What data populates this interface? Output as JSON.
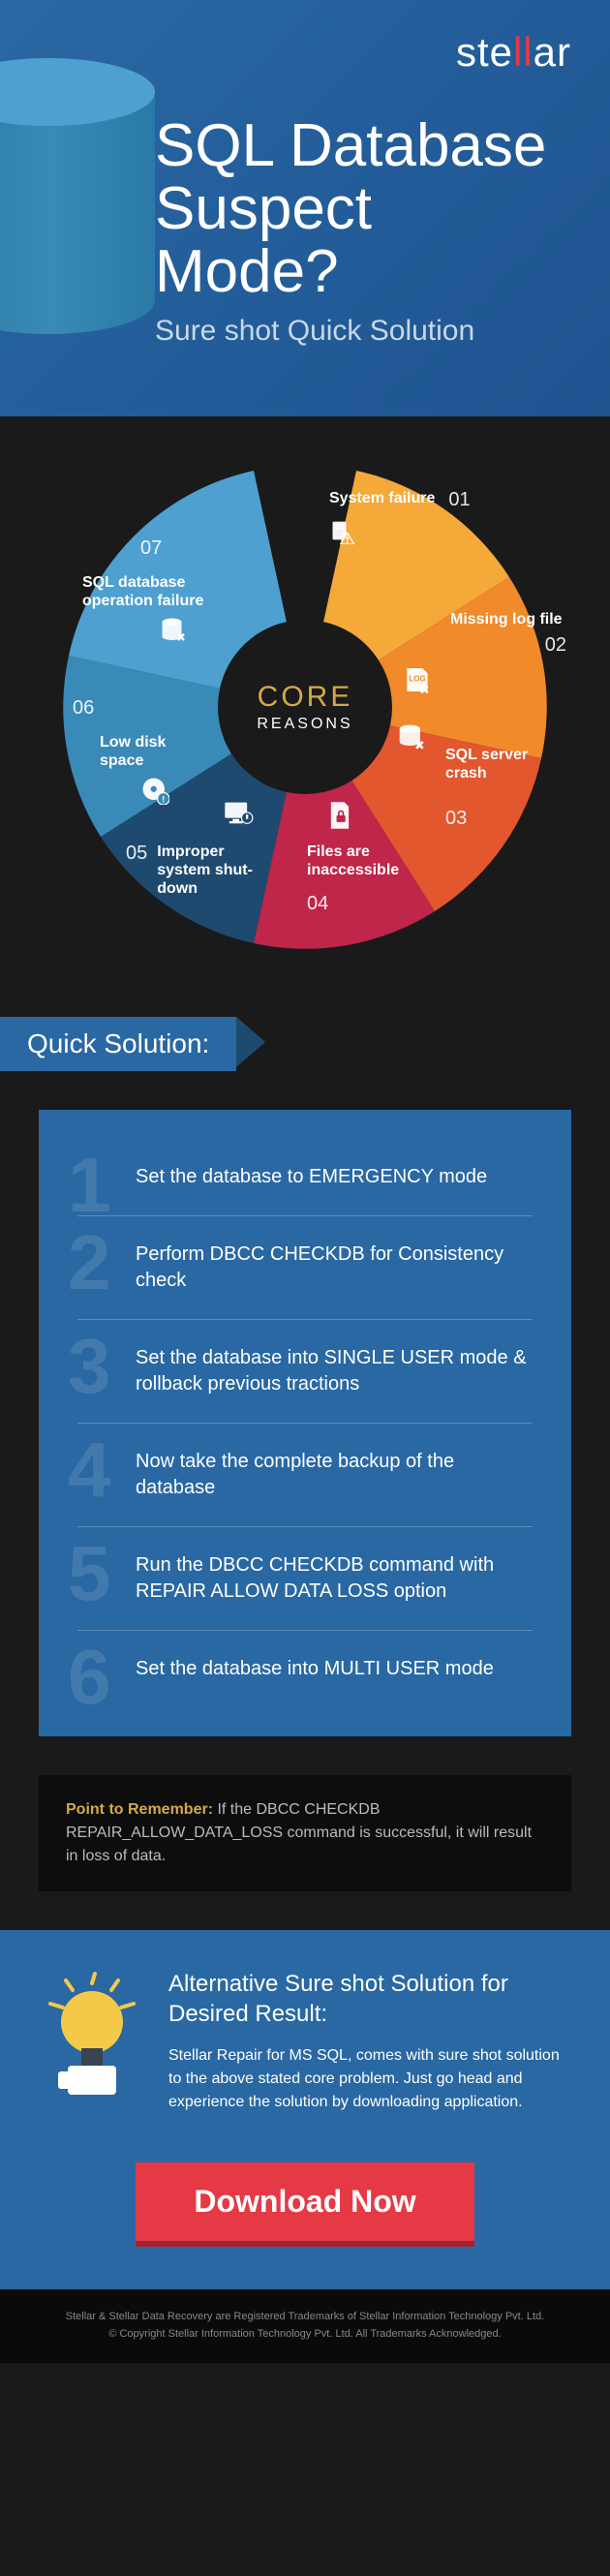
{
  "brand": {
    "pre": "ste",
    "mid": "ll",
    "post": "ar"
  },
  "hero": {
    "title_l1": "SQL Database",
    "title_l2": "Suspect Mode?",
    "sub": "Sure shot Quick Solution"
  },
  "wheel": {
    "center_top": "CORE",
    "center_bottom": "REASONS",
    "segments": [
      {
        "num": "01",
        "label": "System failure",
        "color": "#f4a938",
        "icon": "server-warn-icon"
      },
      {
        "num": "02",
        "label": "Missing log file",
        "color": "#f08a2a",
        "icon": "log-missing-icon"
      },
      {
        "num": "03",
        "label": "SQL server crash",
        "color": "#e2572e",
        "icon": "db-crash-icon"
      },
      {
        "num": "04",
        "label": "Files are inaccessible",
        "color": "#c0254a",
        "icon": "file-lock-icon"
      },
      {
        "num": "05",
        "label": "Improper system shut-down",
        "color": "#1e4a70",
        "icon": "monitor-off-icon"
      },
      {
        "num": "06",
        "label": "Low disk space",
        "color": "#3a8ab8",
        "icon": "disk-low-icon"
      },
      {
        "num": "07",
        "label": "SQL database operation failure",
        "color": "#4da0d0",
        "icon": "db-op-fail-icon"
      }
    ]
  },
  "quick_heading": "Quick Solution:",
  "steps": [
    "Set the database to EMERGENCY mode",
    "Perform DBCC CHECKDB for Consistency check",
    "Set the database into SINGLE USER mode & rollback previous tractions",
    "Now take the complete backup of the database",
    "Run the DBCC CHECKDB command with REPAIR ALLOW DATA LOSS option",
    "Set the database into MULTI USER mode"
  ],
  "remember": {
    "label": "Point to Remember:",
    "text": " If the DBCC CHECKDB REPAIR_ALLOW_DATA_LOSS command is successful, it will result in loss of data."
  },
  "alt": {
    "heading": "Alternative Sure shot Solution for Desired Result:",
    "body": "Stellar Repair for MS SQL, comes with sure shot solution to the above stated core problem. Just go head and experience the solution by downloading application."
  },
  "download": "Download Now",
  "footer": {
    "l1": "Stellar & Stellar Data Recovery are Registered Trademarks of Stellar Information Technology Pvt. Ltd.",
    "l2": "© Copyright Stellar Information Technology Pvt. Ltd. All Trademarks Acknowledged."
  }
}
